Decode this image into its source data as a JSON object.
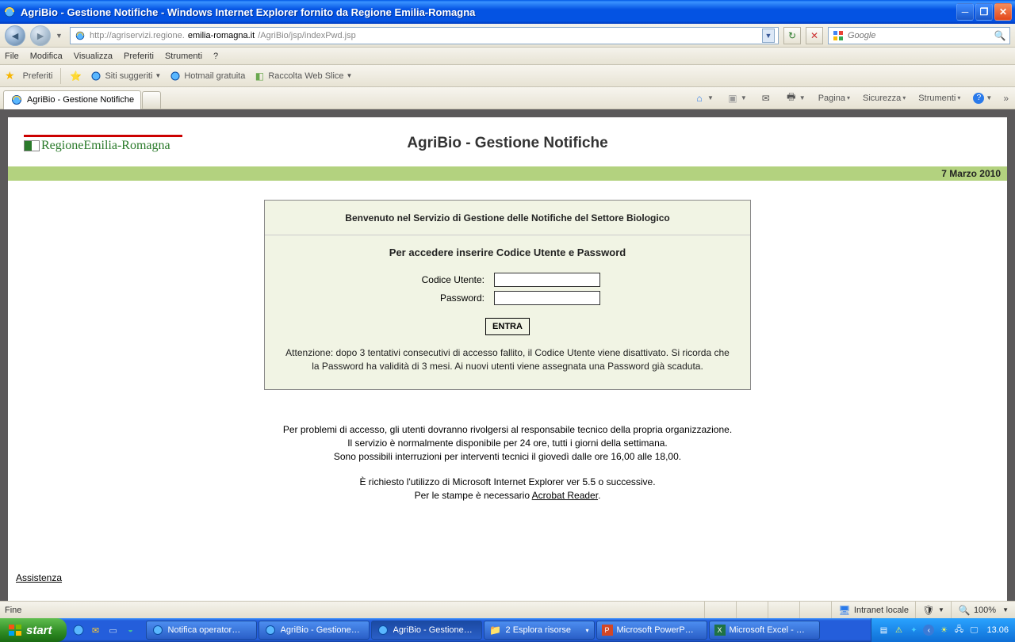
{
  "window": {
    "title": "AgriBio - Gestione Notifiche - Windows Internet Explorer fornito da Regione Emilia-Romagna"
  },
  "address": {
    "url_prefix": "http://agriservizi.regione.",
    "url_bold": "emilia-romagna.it",
    "url_suffix": "/AgriBio/jsp/indexPwd.jsp"
  },
  "search": {
    "placeholder": "Google"
  },
  "menus": {
    "file": "File",
    "modifica": "Modifica",
    "visualizza": "Visualizza",
    "preferiti": "Preferiti",
    "strumenti": "Strumenti",
    "help": "?"
  },
  "favbar": {
    "preferiti": "Preferiti",
    "siti": "Siti suggeriti",
    "hotmail": "Hotmail gratuita",
    "webslice": "Raccolta Web Slice"
  },
  "tab": {
    "title": "AgriBio - Gestione Notifiche"
  },
  "cmdbar": {
    "pagina": "Pagina",
    "sicurezza": "Sicurezza",
    "strumenti": "Strumenti"
  },
  "page": {
    "logo": "RegioneEmilia-Romagna",
    "title": "AgriBio - Gestione Notifiche",
    "date": "7 Marzo 2010",
    "login": {
      "heading": "Benvenuto nel Servizio di Gestione delle Notifiche del Settore Biologico",
      "subheading": "Per accedere inserire Codice Utente e Password",
      "user_label": "Codice Utente:",
      "pwd_label": "Password:",
      "button": "ENTRA",
      "warning": "Attenzione: dopo 3 tentativi consecutivi di accesso fallito, il Codice Utente viene disattivato. Si ricorda che la Password ha validità di 3 mesi. Ai nuovi utenti viene assegnata una Password già scaduta."
    },
    "footer": {
      "l1": "Per problemi di accesso, gli utenti dovranno rivolgersi al responsabile tecnico della propria organizzazione.",
      "l2": "Il servizio è normalmente disponibile per 24 ore, tutti i giorni della settimana.",
      "l3": "Sono possibili interruzioni per interventi tecnici il giovedì dalle ore 16,00 alle 18,00.",
      "l4": "È richiesto l'utilizzo di Microsoft Internet Explorer ver 5.5 o successive.",
      "l5a": "Per le stampe è necessario ",
      "l5b": "Acrobat Reader",
      "l5c": "."
    },
    "assist": "Assistenza"
  },
  "statusbar": {
    "left": "Fine",
    "zone": "Intranet locale",
    "zoom": "100%"
  },
  "taskbar": {
    "start": "start",
    "tasks": [
      "Notifica operator…",
      "AgriBio - Gestione…",
      "AgriBio - Gestione…",
      "2 Esplora risorse",
      "Microsoft PowerP…",
      "Microsoft Excel - …"
    ],
    "clock": "13.06"
  }
}
